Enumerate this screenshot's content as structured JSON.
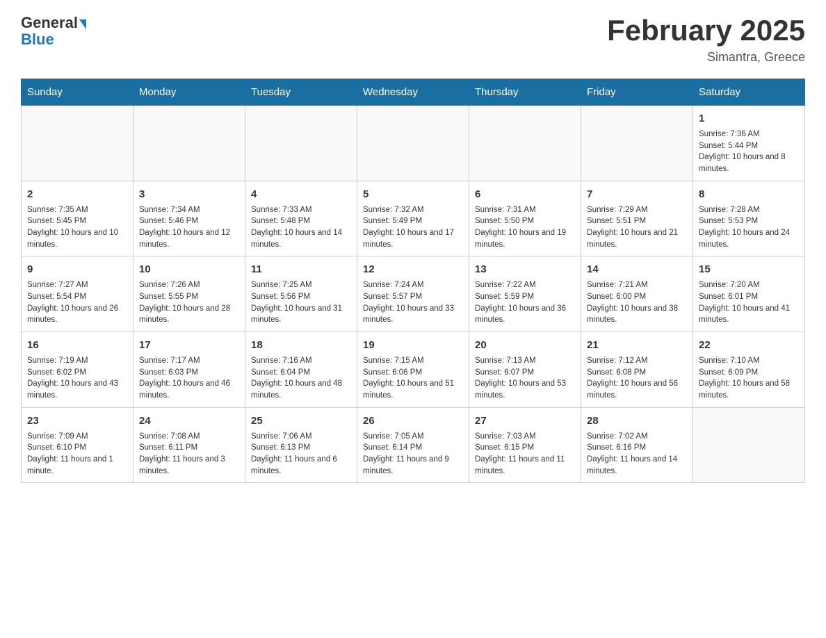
{
  "header": {
    "logo_general": "General",
    "logo_blue": "Blue",
    "month_title": "February 2025",
    "location": "Simantra, Greece"
  },
  "days_of_week": [
    "Sunday",
    "Monday",
    "Tuesday",
    "Wednesday",
    "Thursday",
    "Friday",
    "Saturday"
  ],
  "weeks": [
    {
      "days": [
        {
          "number": "",
          "info": ""
        },
        {
          "number": "",
          "info": ""
        },
        {
          "number": "",
          "info": ""
        },
        {
          "number": "",
          "info": ""
        },
        {
          "number": "",
          "info": ""
        },
        {
          "number": "",
          "info": ""
        },
        {
          "number": "1",
          "info": "Sunrise: 7:36 AM\nSunset: 5:44 PM\nDaylight: 10 hours and 8 minutes."
        }
      ]
    },
    {
      "days": [
        {
          "number": "2",
          "info": "Sunrise: 7:35 AM\nSunset: 5:45 PM\nDaylight: 10 hours and 10 minutes."
        },
        {
          "number": "3",
          "info": "Sunrise: 7:34 AM\nSunset: 5:46 PM\nDaylight: 10 hours and 12 minutes."
        },
        {
          "number": "4",
          "info": "Sunrise: 7:33 AM\nSunset: 5:48 PM\nDaylight: 10 hours and 14 minutes."
        },
        {
          "number": "5",
          "info": "Sunrise: 7:32 AM\nSunset: 5:49 PM\nDaylight: 10 hours and 17 minutes."
        },
        {
          "number": "6",
          "info": "Sunrise: 7:31 AM\nSunset: 5:50 PM\nDaylight: 10 hours and 19 minutes."
        },
        {
          "number": "7",
          "info": "Sunrise: 7:29 AM\nSunset: 5:51 PM\nDaylight: 10 hours and 21 minutes."
        },
        {
          "number": "8",
          "info": "Sunrise: 7:28 AM\nSunset: 5:53 PM\nDaylight: 10 hours and 24 minutes."
        }
      ]
    },
    {
      "days": [
        {
          "number": "9",
          "info": "Sunrise: 7:27 AM\nSunset: 5:54 PM\nDaylight: 10 hours and 26 minutes."
        },
        {
          "number": "10",
          "info": "Sunrise: 7:26 AM\nSunset: 5:55 PM\nDaylight: 10 hours and 28 minutes."
        },
        {
          "number": "11",
          "info": "Sunrise: 7:25 AM\nSunset: 5:56 PM\nDaylight: 10 hours and 31 minutes."
        },
        {
          "number": "12",
          "info": "Sunrise: 7:24 AM\nSunset: 5:57 PM\nDaylight: 10 hours and 33 minutes."
        },
        {
          "number": "13",
          "info": "Sunrise: 7:22 AM\nSunset: 5:59 PM\nDaylight: 10 hours and 36 minutes."
        },
        {
          "number": "14",
          "info": "Sunrise: 7:21 AM\nSunset: 6:00 PM\nDaylight: 10 hours and 38 minutes."
        },
        {
          "number": "15",
          "info": "Sunrise: 7:20 AM\nSunset: 6:01 PM\nDaylight: 10 hours and 41 minutes."
        }
      ]
    },
    {
      "days": [
        {
          "number": "16",
          "info": "Sunrise: 7:19 AM\nSunset: 6:02 PM\nDaylight: 10 hours and 43 minutes."
        },
        {
          "number": "17",
          "info": "Sunrise: 7:17 AM\nSunset: 6:03 PM\nDaylight: 10 hours and 46 minutes."
        },
        {
          "number": "18",
          "info": "Sunrise: 7:16 AM\nSunset: 6:04 PM\nDaylight: 10 hours and 48 minutes."
        },
        {
          "number": "19",
          "info": "Sunrise: 7:15 AM\nSunset: 6:06 PM\nDaylight: 10 hours and 51 minutes."
        },
        {
          "number": "20",
          "info": "Sunrise: 7:13 AM\nSunset: 6:07 PM\nDaylight: 10 hours and 53 minutes."
        },
        {
          "number": "21",
          "info": "Sunrise: 7:12 AM\nSunset: 6:08 PM\nDaylight: 10 hours and 56 minutes."
        },
        {
          "number": "22",
          "info": "Sunrise: 7:10 AM\nSunset: 6:09 PM\nDaylight: 10 hours and 58 minutes."
        }
      ]
    },
    {
      "days": [
        {
          "number": "23",
          "info": "Sunrise: 7:09 AM\nSunset: 6:10 PM\nDaylight: 11 hours and 1 minute."
        },
        {
          "number": "24",
          "info": "Sunrise: 7:08 AM\nSunset: 6:11 PM\nDaylight: 11 hours and 3 minutes."
        },
        {
          "number": "25",
          "info": "Sunrise: 7:06 AM\nSunset: 6:13 PM\nDaylight: 11 hours and 6 minutes."
        },
        {
          "number": "26",
          "info": "Sunrise: 7:05 AM\nSunset: 6:14 PM\nDaylight: 11 hours and 9 minutes."
        },
        {
          "number": "27",
          "info": "Sunrise: 7:03 AM\nSunset: 6:15 PM\nDaylight: 11 hours and 11 minutes."
        },
        {
          "number": "28",
          "info": "Sunrise: 7:02 AM\nSunset: 6:16 PM\nDaylight: 11 hours and 14 minutes."
        },
        {
          "number": "",
          "info": ""
        }
      ]
    }
  ]
}
